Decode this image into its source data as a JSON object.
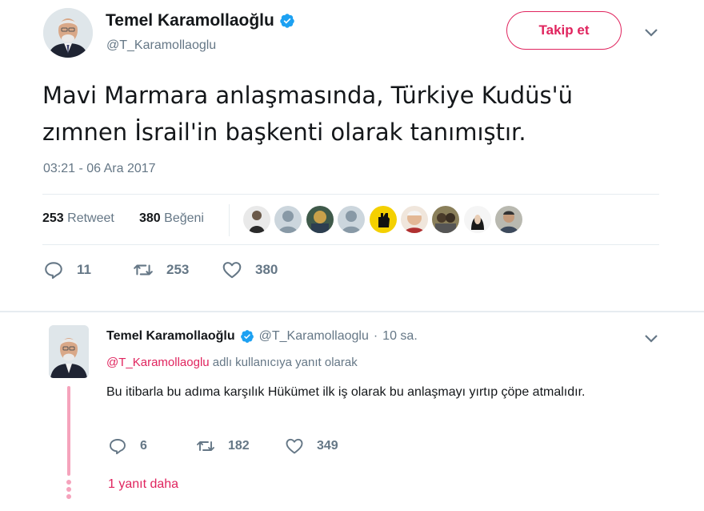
{
  "main_tweet": {
    "display_name": "Temel Karamollaoğlu",
    "handle": "@T_Karamollaoglu",
    "follow_label": "Takip et",
    "text_line1": "Mavi Marmara anlaşmasında, Türkiye Kudüs'ü",
    "text_line2": "zımnen İsrail'in başkenti olarak tanımıştır.",
    "timestamp": "03:21 - 06 Ara 2017",
    "stats": {
      "retweet_count": "253",
      "retweet_label": "Retweet",
      "like_count": "380",
      "like_label": "Beğeni"
    },
    "likers": [
      "liker-avatar-1",
      "liker-avatar-2",
      "liker-avatar-3",
      "liker-avatar-4",
      "liker-avatar-5",
      "liker-avatar-6",
      "liker-avatar-7",
      "liker-avatar-8",
      "liker-avatar-9"
    ],
    "actions": {
      "reply_count": "11",
      "retweet_count": "253",
      "like_count": "380"
    }
  },
  "reply_tweet": {
    "display_name": "Temel Karamollaoğlu",
    "handle": "@T_Karamollaoglu",
    "dot": "·",
    "time": "10 sa.",
    "context_mention": "@T_Karamollaoglu",
    "context_text": "adlı kullanıcıya yanıt olarak",
    "text": "Bu itibarla bu adıma karşılık Hükümet ilk iş olarak bu anlaşmayı yırtıp çöpe atmalıdır.",
    "actions": {
      "reply_count": "6",
      "retweet_count": "182",
      "like_count": "349"
    },
    "more_replies": "1 yanıt daha"
  },
  "colors": {
    "accent": "#e0245e",
    "muted": "#657786",
    "verified": "#1da1f2",
    "divider": "#e6ecf0"
  },
  "icons": [
    "verified-badge-icon",
    "chevron-down-icon",
    "reply-icon",
    "retweet-icon",
    "heart-icon"
  ]
}
